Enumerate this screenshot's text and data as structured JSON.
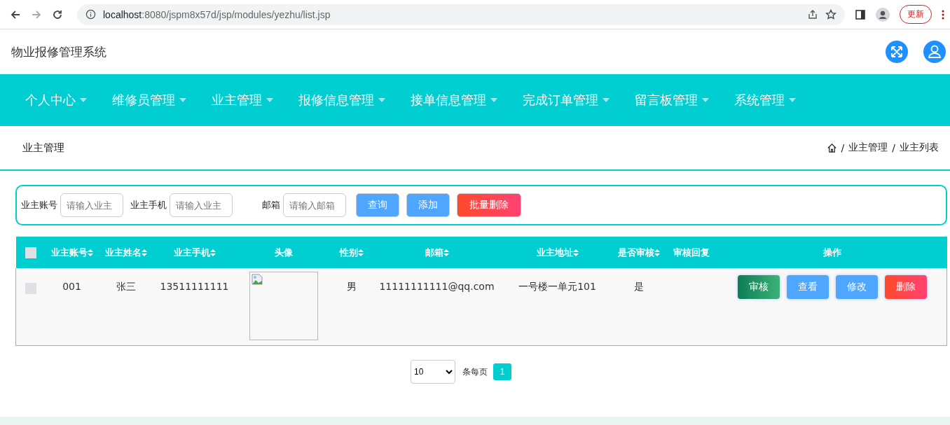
{
  "browser": {
    "url_host": "localhost",
    "url_rest": ":8080/jspm8x57d/jsp/modules/yezhu/list.jsp",
    "back_disabled": false,
    "forward_disabled": true,
    "update_button": "更新"
  },
  "header": {
    "title": "物业报修管理系统"
  },
  "nav": [
    {
      "label": "个人中心"
    },
    {
      "label": "维修员管理"
    },
    {
      "label": "业主管理"
    },
    {
      "label": "报修信息管理"
    },
    {
      "label": "接单信息管理"
    },
    {
      "label": "完成订单管理"
    },
    {
      "label": "留言板管理"
    },
    {
      "label": "系统管理"
    }
  ],
  "page_title": "业主管理",
  "breadcrumb": {
    "separator": "/",
    "items": [
      "业主管理",
      "业主列表"
    ]
  },
  "search": {
    "fields": [
      {
        "label": "业主账号",
        "placeholder": "请输入业主"
      },
      {
        "label": "业主手机",
        "placeholder": "请输入业主"
      },
      {
        "label": "邮箱",
        "placeholder": "请输入邮箱"
      }
    ],
    "buttons": [
      {
        "label": "查询",
        "kind": "primary"
      },
      {
        "label": "添加",
        "kind": "primary"
      },
      {
        "label": "批量删除",
        "kind": "danger"
      }
    ]
  },
  "table": {
    "select_all_checked": false,
    "columns": [
      {
        "label": "业主账号",
        "sortable": true
      },
      {
        "label": "业主姓名",
        "sortable": true
      },
      {
        "label": "业主手机",
        "sortable": true
      },
      {
        "label": "头像",
        "sortable": false
      },
      {
        "label": "性别",
        "sortable": true
      },
      {
        "label": "邮箱",
        "sortable": true
      },
      {
        "label": "业主地址",
        "sortable": true
      },
      {
        "label": "是否审核",
        "sortable": true
      },
      {
        "label": "审核回复",
        "sortable": false
      },
      {
        "label": "操作",
        "sortable": false
      }
    ],
    "rows": [
      {
        "checked": false,
        "cells": [
          "001",
          "张三",
          "13511111111",
          null,
          "男",
          "11111111111@qq.com",
          "一号楼一单元101",
          "是",
          ""
        ],
        "actions": [
          {
            "label": "审核",
            "kind": "success"
          },
          {
            "label": "查看",
            "kind": "primary"
          },
          {
            "label": "修改",
            "kind": "primary"
          },
          {
            "label": "删除",
            "kind": "danger"
          }
        ]
      }
    ]
  },
  "pagination": {
    "page_size": "10",
    "per_page_label": "条每页",
    "pages": [
      {
        "label": "1",
        "selected": true
      }
    ]
  }
}
